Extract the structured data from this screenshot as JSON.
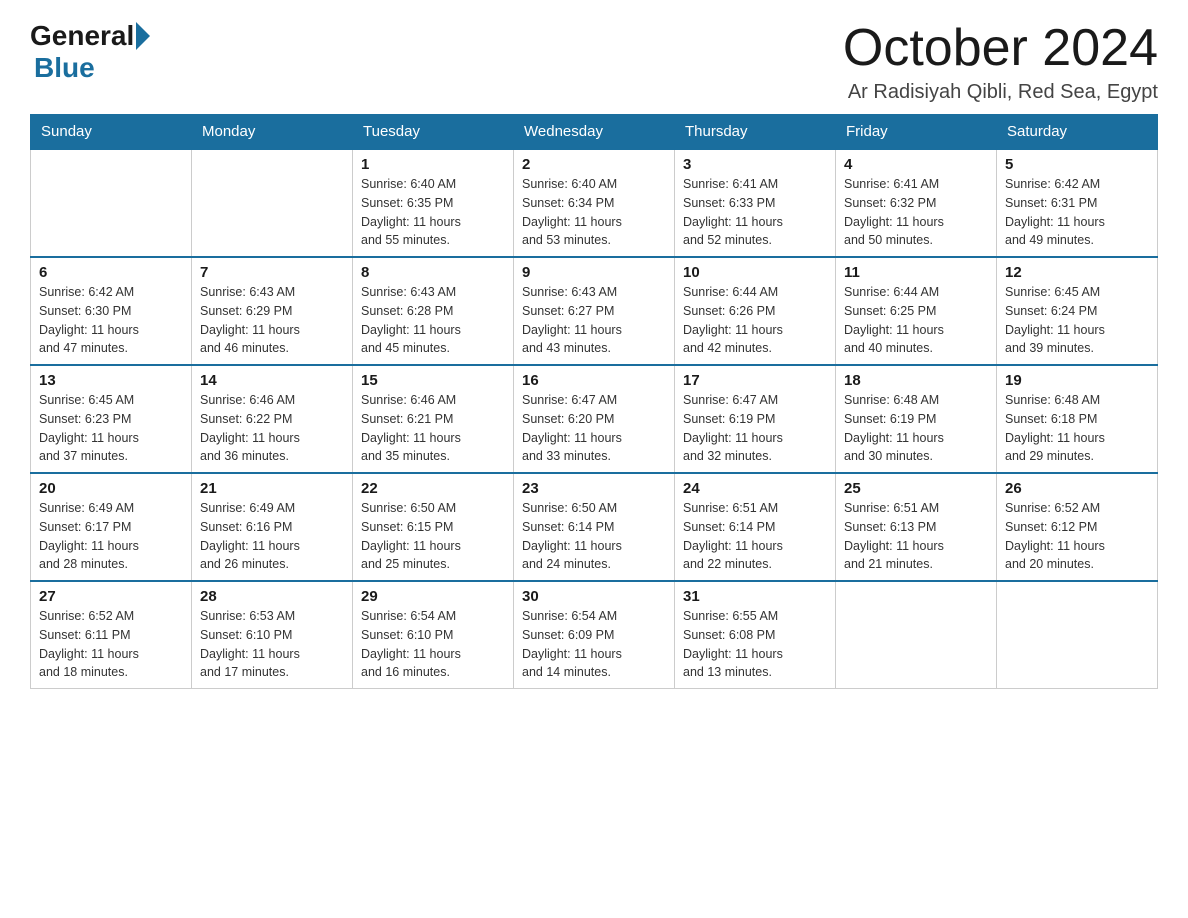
{
  "header": {
    "logo_general": "General",
    "logo_blue": "Blue",
    "month_title": "October 2024",
    "location": "Ar Radisiyah Qibli, Red Sea, Egypt"
  },
  "days_of_week": [
    "Sunday",
    "Monday",
    "Tuesday",
    "Wednesday",
    "Thursday",
    "Friday",
    "Saturday"
  ],
  "weeks": [
    [
      {
        "day": "",
        "info": ""
      },
      {
        "day": "",
        "info": ""
      },
      {
        "day": "1",
        "info": "Sunrise: 6:40 AM\nSunset: 6:35 PM\nDaylight: 11 hours\nand 55 minutes."
      },
      {
        "day": "2",
        "info": "Sunrise: 6:40 AM\nSunset: 6:34 PM\nDaylight: 11 hours\nand 53 minutes."
      },
      {
        "day": "3",
        "info": "Sunrise: 6:41 AM\nSunset: 6:33 PM\nDaylight: 11 hours\nand 52 minutes."
      },
      {
        "day": "4",
        "info": "Sunrise: 6:41 AM\nSunset: 6:32 PM\nDaylight: 11 hours\nand 50 minutes."
      },
      {
        "day": "5",
        "info": "Sunrise: 6:42 AM\nSunset: 6:31 PM\nDaylight: 11 hours\nand 49 minutes."
      }
    ],
    [
      {
        "day": "6",
        "info": "Sunrise: 6:42 AM\nSunset: 6:30 PM\nDaylight: 11 hours\nand 47 minutes."
      },
      {
        "day": "7",
        "info": "Sunrise: 6:43 AM\nSunset: 6:29 PM\nDaylight: 11 hours\nand 46 minutes."
      },
      {
        "day": "8",
        "info": "Sunrise: 6:43 AM\nSunset: 6:28 PM\nDaylight: 11 hours\nand 45 minutes."
      },
      {
        "day": "9",
        "info": "Sunrise: 6:43 AM\nSunset: 6:27 PM\nDaylight: 11 hours\nand 43 minutes."
      },
      {
        "day": "10",
        "info": "Sunrise: 6:44 AM\nSunset: 6:26 PM\nDaylight: 11 hours\nand 42 minutes."
      },
      {
        "day": "11",
        "info": "Sunrise: 6:44 AM\nSunset: 6:25 PM\nDaylight: 11 hours\nand 40 minutes."
      },
      {
        "day": "12",
        "info": "Sunrise: 6:45 AM\nSunset: 6:24 PM\nDaylight: 11 hours\nand 39 minutes."
      }
    ],
    [
      {
        "day": "13",
        "info": "Sunrise: 6:45 AM\nSunset: 6:23 PM\nDaylight: 11 hours\nand 37 minutes."
      },
      {
        "day": "14",
        "info": "Sunrise: 6:46 AM\nSunset: 6:22 PM\nDaylight: 11 hours\nand 36 minutes."
      },
      {
        "day": "15",
        "info": "Sunrise: 6:46 AM\nSunset: 6:21 PM\nDaylight: 11 hours\nand 35 minutes."
      },
      {
        "day": "16",
        "info": "Sunrise: 6:47 AM\nSunset: 6:20 PM\nDaylight: 11 hours\nand 33 minutes."
      },
      {
        "day": "17",
        "info": "Sunrise: 6:47 AM\nSunset: 6:19 PM\nDaylight: 11 hours\nand 32 minutes."
      },
      {
        "day": "18",
        "info": "Sunrise: 6:48 AM\nSunset: 6:19 PM\nDaylight: 11 hours\nand 30 minutes."
      },
      {
        "day": "19",
        "info": "Sunrise: 6:48 AM\nSunset: 6:18 PM\nDaylight: 11 hours\nand 29 minutes."
      }
    ],
    [
      {
        "day": "20",
        "info": "Sunrise: 6:49 AM\nSunset: 6:17 PM\nDaylight: 11 hours\nand 28 minutes."
      },
      {
        "day": "21",
        "info": "Sunrise: 6:49 AM\nSunset: 6:16 PM\nDaylight: 11 hours\nand 26 minutes."
      },
      {
        "day": "22",
        "info": "Sunrise: 6:50 AM\nSunset: 6:15 PM\nDaylight: 11 hours\nand 25 minutes."
      },
      {
        "day": "23",
        "info": "Sunrise: 6:50 AM\nSunset: 6:14 PM\nDaylight: 11 hours\nand 24 minutes."
      },
      {
        "day": "24",
        "info": "Sunrise: 6:51 AM\nSunset: 6:14 PM\nDaylight: 11 hours\nand 22 minutes."
      },
      {
        "day": "25",
        "info": "Sunrise: 6:51 AM\nSunset: 6:13 PM\nDaylight: 11 hours\nand 21 minutes."
      },
      {
        "day": "26",
        "info": "Sunrise: 6:52 AM\nSunset: 6:12 PM\nDaylight: 11 hours\nand 20 minutes."
      }
    ],
    [
      {
        "day": "27",
        "info": "Sunrise: 6:52 AM\nSunset: 6:11 PM\nDaylight: 11 hours\nand 18 minutes."
      },
      {
        "day": "28",
        "info": "Sunrise: 6:53 AM\nSunset: 6:10 PM\nDaylight: 11 hours\nand 17 minutes."
      },
      {
        "day": "29",
        "info": "Sunrise: 6:54 AM\nSunset: 6:10 PM\nDaylight: 11 hours\nand 16 minutes."
      },
      {
        "day": "30",
        "info": "Sunrise: 6:54 AM\nSunset: 6:09 PM\nDaylight: 11 hours\nand 14 minutes."
      },
      {
        "day": "31",
        "info": "Sunrise: 6:55 AM\nSunset: 6:08 PM\nDaylight: 11 hours\nand 13 minutes."
      },
      {
        "day": "",
        "info": ""
      },
      {
        "day": "",
        "info": ""
      }
    ]
  ]
}
